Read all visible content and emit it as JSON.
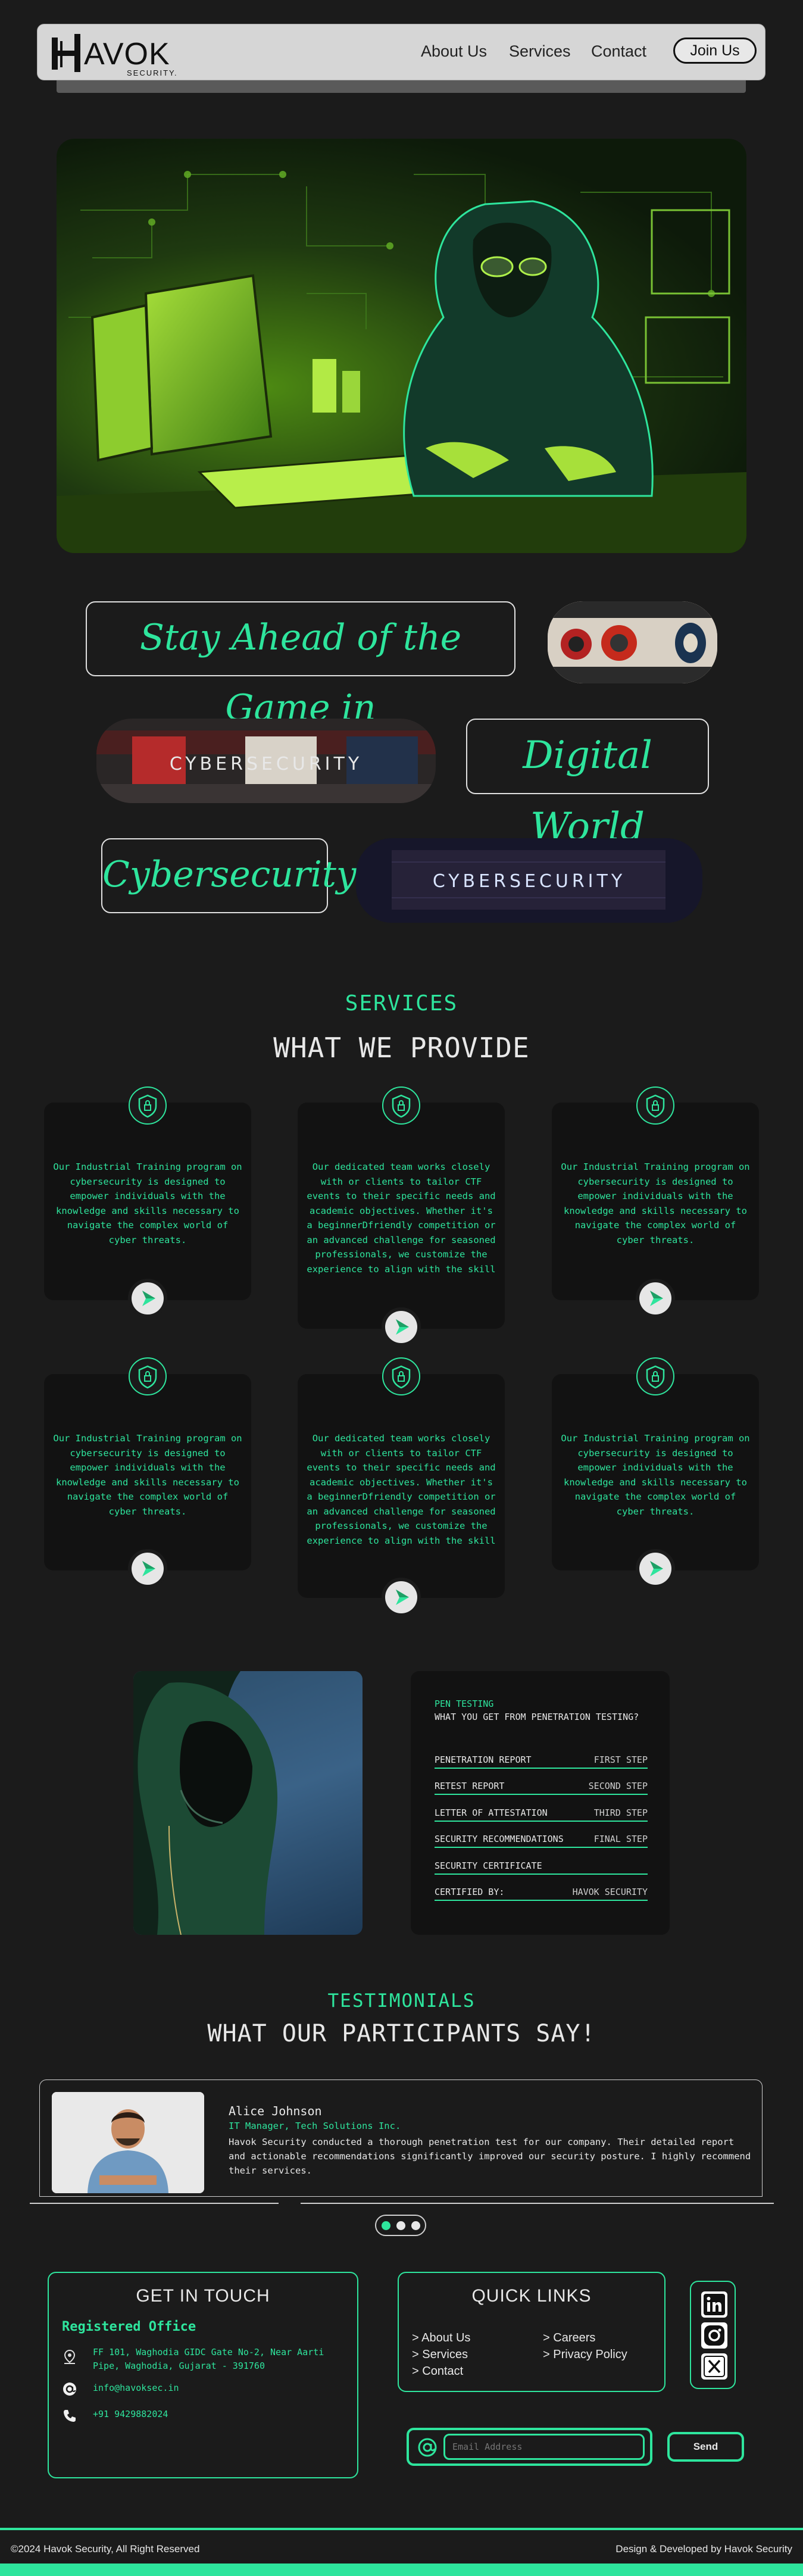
{
  "nav": {
    "brand": "AVOK",
    "brand_sub": "SECURITY.",
    "links": [
      "About Us",
      "Services",
      "Contact"
    ],
    "cta": "Join Us"
  },
  "tagline": {
    "line1": "Stay Ahead of the Game in",
    "line2": "Digital World",
    "line3": "Cybersecurity",
    "banner1": "CYBERSECURITY",
    "banner2": "CYBERSECURITY"
  },
  "services": {
    "kicker": "SERVICES",
    "title": "WHAT WE PROVIDE",
    "cards": [
      {
        "text": "Our Industrial Training program on cybersecurity is designed to empower individuals with the knowledge and skills necessary to navigate the complex world of cyber threats."
      },
      {
        "text": "Our dedicated team works closely with or clients to tailor CTF events to their specific needs and academic objectives. Whether it's a beginnerDfriendly competition or an advanced challenge for seasoned professionals, we customize the experience to align with the skill"
      },
      {
        "text": "Our Industrial Training program on cybersecurity is designed to empower individuals with the knowledge and skills necessary to navigate the complex world of cyber threats."
      },
      {
        "text": "Our Industrial Training program on cybersecurity is designed to empower individuals with the knowledge and skills necessary to navigate the complex world of cyber threats."
      },
      {
        "text": "Our dedicated team works closely with or clients to tailor CTF events to their specific needs and academic objectives. Whether it's a beginnerDfriendly competition or an advanced challenge for seasoned professionals, we customize the experience to align with the skill"
      },
      {
        "text": "Our Industrial Training program on cybersecurity is designed to empower individuals with the knowledge and skills necessary to navigate the complex world of cyber threats."
      }
    ]
  },
  "pentest": {
    "kicker": "PEN TESTING",
    "question": "WHAT YOU GET FROM PENETRATION TESTING?",
    "rows": [
      {
        "label": "PENETRATION REPORT",
        "step": "FIRST STEP"
      },
      {
        "label": "RETEST REPORT",
        "step": "SECOND STEP"
      },
      {
        "label": "LETTER OF ATTESTATION",
        "step": "THIRD STEP"
      },
      {
        "label": "SECURITY RECOMMENDATIONS",
        "step": "FINAL STEP"
      },
      {
        "label": "SECURITY CERTIFICATE",
        "step": ""
      }
    ],
    "certified_label": "CERTIFIED BY:",
    "certified_value": "HAVOK SECURITY"
  },
  "testimonials": {
    "kicker": "TESTIMONIALS",
    "title": "WHAT OUR PARTICIPANTS SAY!",
    "name": "Alice Johnson",
    "role": "IT Manager, Tech Solutions Inc.",
    "quote": "Havok Security conducted a thorough penetration test for our company. Their detailed report and actionable recommendations significantly improved our security posture. I highly recommend their services."
  },
  "contact": {
    "title": "GET IN TOUCH",
    "office_label": "Registered Office",
    "address": "FF 101, Waghodia GIDC Gate No-2, Near Aarti Pipe, Waghodia, Gujarat - 391760",
    "email": "info@havoksec.in",
    "phone": "+91 9429882024"
  },
  "quick_links": {
    "title": "QUICK LINKS",
    "col1": [
      "About Us",
      "Services",
      "Contact"
    ],
    "col2": [
      "Careers",
      "Privacy Policy"
    ]
  },
  "social": [
    "linkedin-icon",
    "instagram-icon",
    "x-icon"
  ],
  "newsletter": {
    "placeholder": "Email Address",
    "send": "Send"
  },
  "footer": {
    "copyright": "©2024 Havok Security, All Right Reserved",
    "credit": "Design & Developed by Havok Security"
  },
  "colors": {
    "accent": "#2ee59d",
    "background": "#1b1b1b",
    "card": "#121212"
  }
}
